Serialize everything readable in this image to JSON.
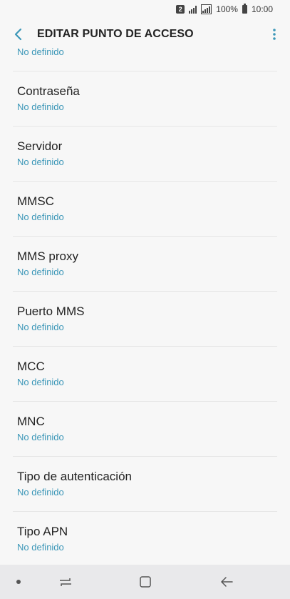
{
  "status": {
    "sim_slot": "2",
    "battery_percent": "100%",
    "time": "10:00"
  },
  "appbar": {
    "title": "EDITAR PUNTO DE ACCESO",
    "back_icon": "chevron-left-icon",
    "menu_icon": "more-vertical-icon",
    "accent_color": "#3c97b8"
  },
  "settings": {
    "items": [
      {
        "label": "",
        "value": "No definido"
      },
      {
        "label": "Contraseña",
        "value": "No definido"
      },
      {
        "label": "Servidor",
        "value": "No definido"
      },
      {
        "label": "MMSC",
        "value": "No definido"
      },
      {
        "label": "MMS proxy",
        "value": "No definido"
      },
      {
        "label": "Puerto MMS",
        "value": "No definido"
      },
      {
        "label": "MCC",
        "value": "No definido"
      },
      {
        "label": "MNC",
        "value": "No definido"
      },
      {
        "label": "Tipo de autenticación",
        "value": "No definido"
      },
      {
        "label": "Tipo APN",
        "value": "No definido"
      }
    ]
  },
  "navbar": {
    "icons": [
      "dot-indicator-icon",
      "recents-icon",
      "home-icon",
      "back-arrow-icon"
    ]
  }
}
